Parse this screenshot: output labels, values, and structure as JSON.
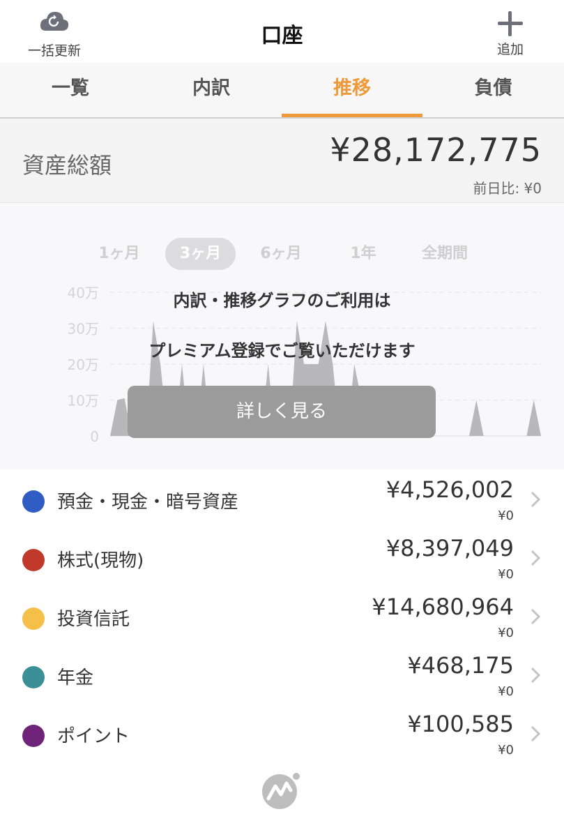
{
  "header": {
    "title": "口座",
    "refresh_label": "一括更新",
    "add_label": "追加",
    "refresh_icon": "cloud-refresh-icon",
    "add_icon": "plus-icon"
  },
  "tabs": [
    {
      "label": "一覧",
      "active": false
    },
    {
      "label": "内訳",
      "active": false
    },
    {
      "label": "推移",
      "active": true
    },
    {
      "label": "負債",
      "active": false
    }
  ],
  "summary": {
    "label": "資産総額",
    "value": "¥28,172,775",
    "change": "前日比: ¥0"
  },
  "chart": {
    "periods": [
      "1ヶ月",
      "3ヶ月",
      "6ヶ月",
      "1年",
      "全期間"
    ],
    "active_period": "3ヶ月",
    "y_ticks": [
      "40万",
      "30万",
      "20万",
      "10万",
      "0"
    ],
    "overlay_line1": "内訳・推移グラフのご利用は",
    "overlay_line2": "プレミアム登録でご覧いただけます",
    "detail_button": "詳しく見る"
  },
  "chart_data": {
    "type": "area",
    "y_tick_labels": [
      "40万",
      "30万",
      "20万",
      "10万",
      "0"
    ],
    "ylim": [
      0,
      400000
    ],
    "grid": true,
    "x": [
      0,
      1,
      2,
      3,
      4,
      5,
      6,
      7,
      8,
      9,
      10,
      11,
      12,
      13,
      14,
      15,
      16,
      17,
      18,
      19,
      20,
      21,
      22,
      23,
      24,
      25,
      26,
      27,
      28,
      29,
      30,
      31,
      32,
      33,
      34,
      35,
      36,
      37,
      38,
      39,
      40,
      41,
      42,
      43,
      44,
      45,
      46,
      47,
      48,
      49,
      50,
      51,
      52,
      53,
      54,
      55,
      56,
      57,
      58,
      59,
      60
    ],
    "values": [
      0,
      100000,
      105000,
      0,
      0,
      0,
      320000,
      200000,
      0,
      0,
      200000,
      0,
      0,
      200000,
      0,
      0,
      0,
      0,
      0,
      0,
      0,
      0,
      200000,
      0,
      0,
      0,
      320000,
      200000,
      200000,
      200000,
      320000,
      200000,
      0,
      0,
      200000,
      100000,
      0,
      0,
      0,
      0,
      0,
      0,
      0,
      0,
      0,
      0,
      0,
      0,
      0,
      0,
      0,
      100000,
      0,
      0,
      0,
      0,
      0,
      0,
      0,
      100000,
      0
    ]
  },
  "categories": [
    {
      "name": "預金・現金・暗号資産",
      "amount": "¥4,526,002",
      "change": "¥0",
      "color": "#2f5dc4"
    },
    {
      "name": "株式(現物)",
      "amount": "¥8,397,049",
      "change": "¥0",
      "color": "#c0392b"
    },
    {
      "name": "投資信託",
      "amount": "¥14,680,964",
      "change": "¥0",
      "color": "#f5c04a"
    },
    {
      "name": "年金",
      "amount": "¥468,175",
      "change": "¥0",
      "color": "#3b9098"
    },
    {
      "name": "ポイント",
      "amount": "¥100,585",
      "change": "¥0",
      "color": "#6f2379"
    }
  ],
  "colors": {
    "accent": "#ee9a3a",
    "chart_fill": "#b8b8bb"
  }
}
